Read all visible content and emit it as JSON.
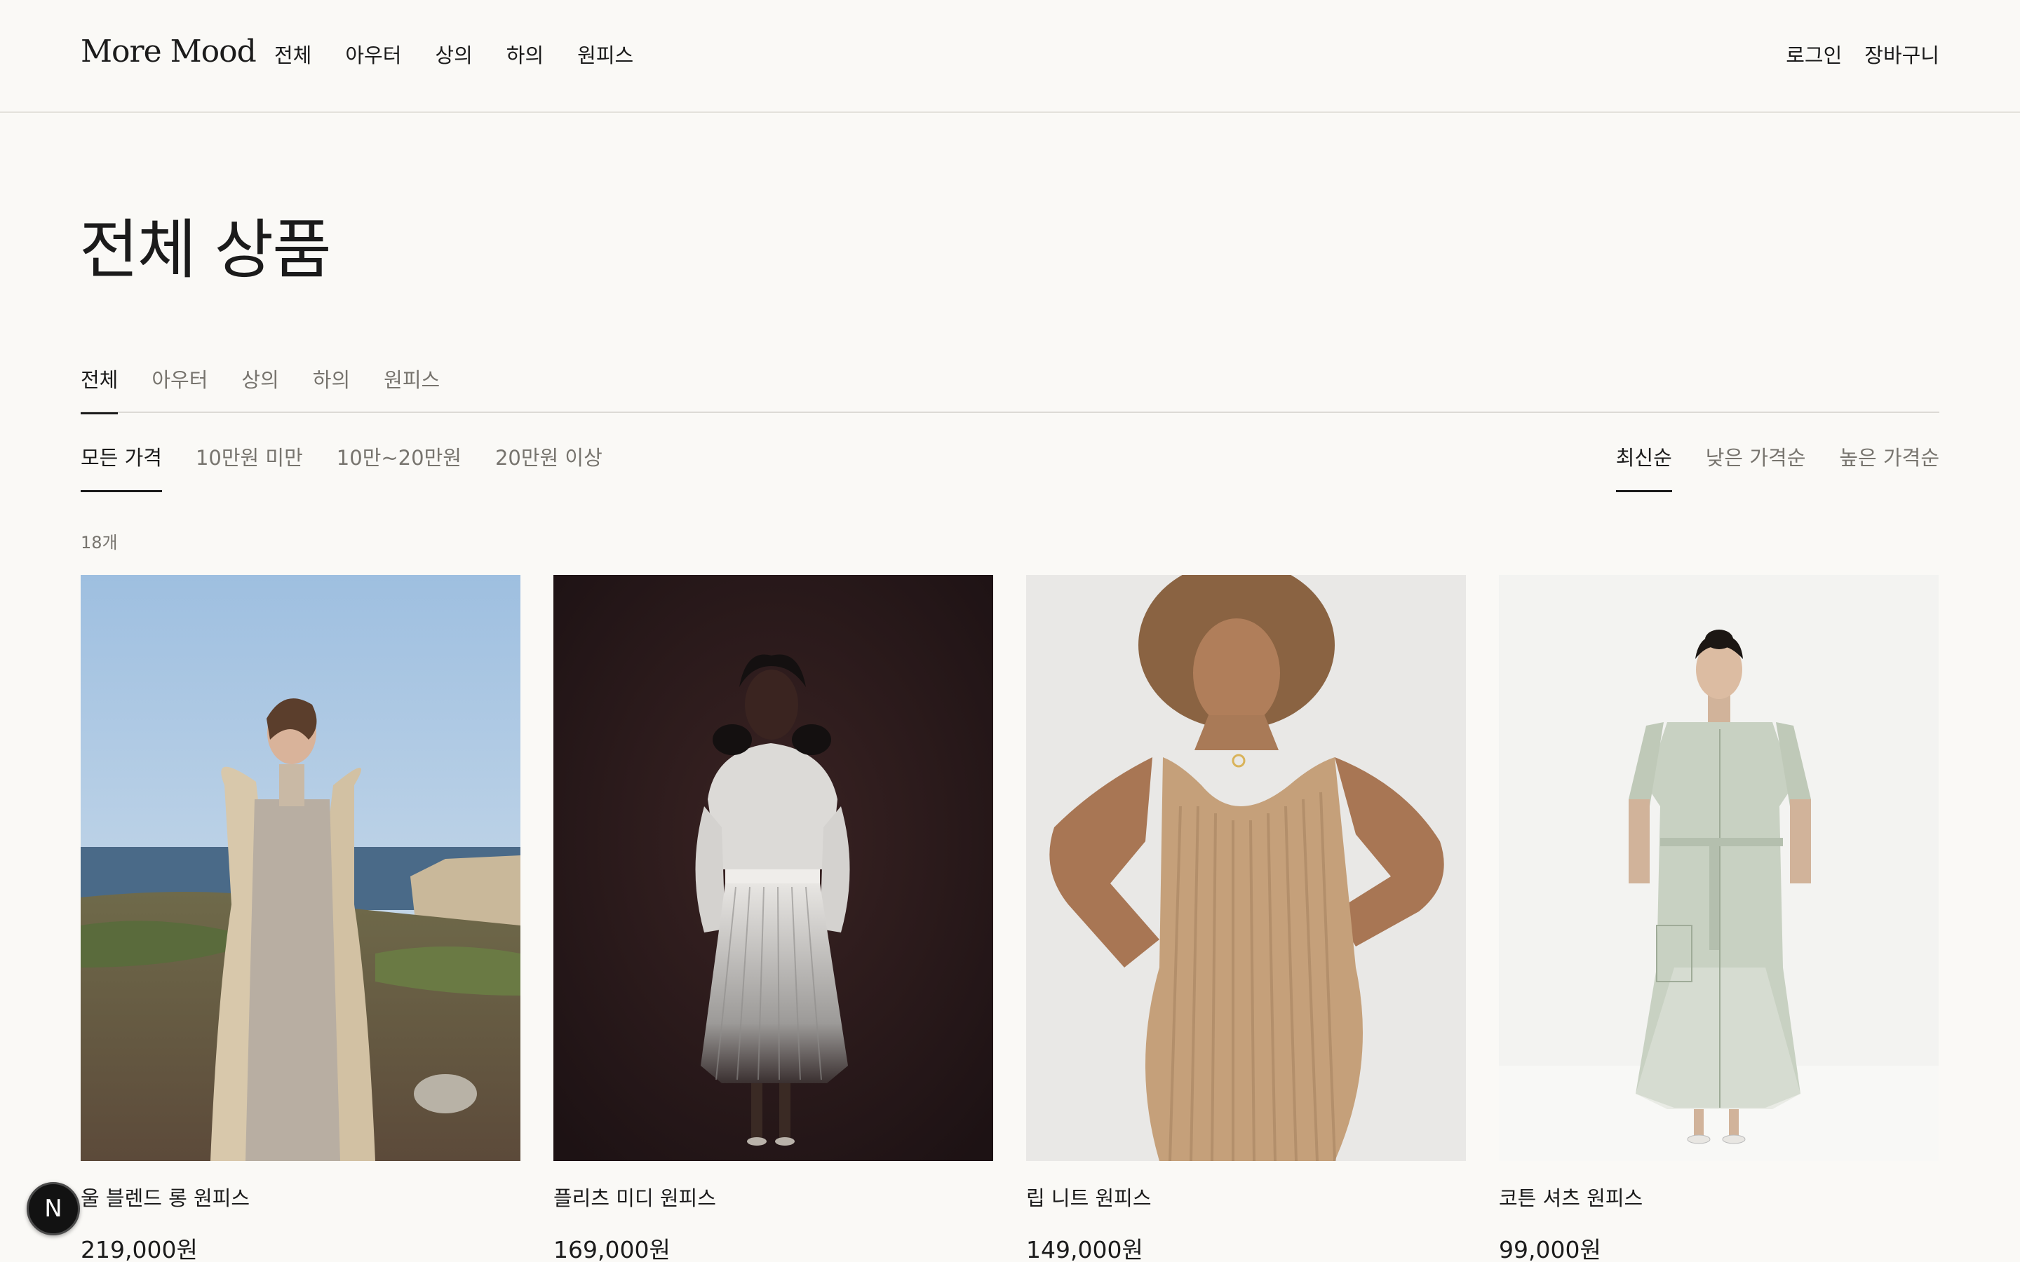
{
  "brand": {
    "logo": "More Mood"
  },
  "header": {
    "nav": [
      "전체",
      "아우터",
      "상의",
      "하의",
      "원피스"
    ],
    "login": "로그인",
    "cart": "장바구니"
  },
  "page": {
    "title": "전체 상품"
  },
  "categories": [
    {
      "label": "전체",
      "active": true
    },
    {
      "label": "아우터",
      "active": false
    },
    {
      "label": "상의",
      "active": false
    },
    {
      "label": "하의",
      "active": false
    },
    {
      "label": "원피스",
      "active": false
    }
  ],
  "price_filters": [
    {
      "label": "모든 가격",
      "active": true
    },
    {
      "label": "10만원 미만",
      "active": false
    },
    {
      "label": "10만~20만원",
      "active": false
    },
    {
      "label": "20만원 이상",
      "active": false
    }
  ],
  "sort": [
    {
      "label": "최신순",
      "active": true
    },
    {
      "label": "낮은 가격순",
      "active": false
    },
    {
      "label": "높은 가격순",
      "active": false
    }
  ],
  "result_count": "18개",
  "products": [
    {
      "name": "울 블렌드 롱 원피스",
      "price": "219,000원"
    },
    {
      "name": "플리츠 미디 원피스",
      "price": "169,000원"
    },
    {
      "name": "립 니트 원피스",
      "price": "149,000원"
    },
    {
      "name": "코튼 셔츠 원피스",
      "price": "99,000원"
    }
  ],
  "dev_badge": {
    "letter": "N"
  }
}
